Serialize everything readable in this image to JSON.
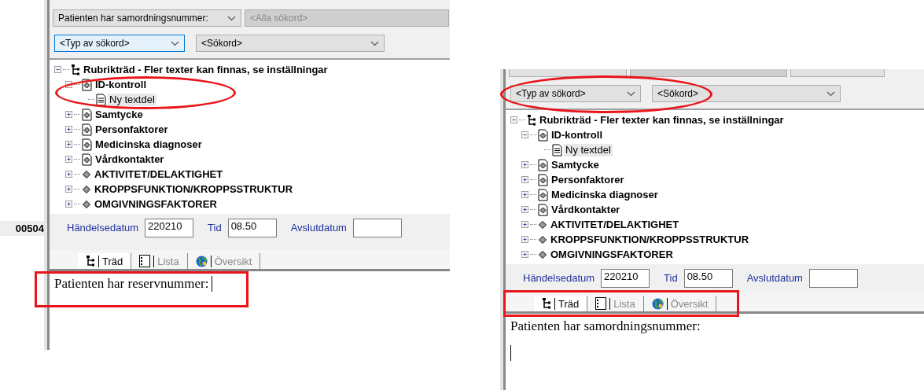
{
  "panels": [
    {
      "gutter_text": "00504",
      "top_combos": [
        {
          "value": "Patienten har samordningsnummer:",
          "disabled": false
        },
        {
          "value": "<Alla sökord>",
          "disabled": true
        }
      ],
      "search_combos": [
        {
          "value": "<Typ av sökord>",
          "focused": true
        },
        {
          "value": "<Sökord>",
          "focused": false
        }
      ],
      "tree": {
        "label": "Rubrikträd - Fler texter kan finnas, se inställningar",
        "expanded": true,
        "children": [
          {
            "label": "ID-kontroll",
            "kind": "document",
            "expanded": true,
            "children": [
              {
                "label": "Ny textdel",
                "kind": "page",
                "selected": true
              }
            ]
          },
          {
            "label": "Samtycke",
            "kind": "document",
            "expanded": false
          },
          {
            "label": "Personfaktorer",
            "kind": "document",
            "expanded": false
          },
          {
            "label": "Medicinska diagnoser",
            "kind": "document",
            "expanded": false
          },
          {
            "label": "Vårdkontakter",
            "kind": "document",
            "expanded": false
          },
          {
            "label": "AKTIVITET/DELAKTIGHET",
            "kind": "category",
            "expanded": false
          },
          {
            "label": "KROPPSFUNKTION/KROPPSSTRUKTUR",
            "kind": "category",
            "expanded": false
          },
          {
            "label": "OMGIVNINGSFAKTORER",
            "kind": "category",
            "expanded": false
          }
        ]
      },
      "date_fields": [
        {
          "label": "Händelsedatum",
          "value": "220210"
        },
        {
          "label": "Tid",
          "value": "08.50"
        },
        {
          "label": "Avslutdatum"
        }
      ],
      "tabs": [
        {
          "label": "Träd",
          "kind": "tree",
          "selected": true
        },
        {
          "label": "Lista",
          "kind": "list",
          "selected": false
        },
        {
          "label": "Översikt",
          "kind": "globe",
          "selected": false
        }
      ],
      "editor": {
        "text": "Patienten har reservnummer:"
      },
      "annotations": [
        {
          "kind": "ellipse"
        },
        {
          "kind": "rectangle"
        }
      ]
    },
    {
      "top_combos": [
        {
          "disabled": false
        },
        {
          "disabled": true
        },
        {
          "disabled": false
        }
      ],
      "search_combos": [
        {
          "value": "<Typ av sökord>",
          "focused": false
        },
        {
          "value": "<Sökord>",
          "focused": false
        }
      ],
      "tree": {
        "label": "Rubrikträd - Fler texter kan finnas, se inställningar",
        "expanded": true,
        "children": [
          {
            "label": "ID-kontroll",
            "kind": "document",
            "expanded": true,
            "children": [
              {
                "label": "Ny textdel",
                "kind": "page",
                "selected": true
              }
            ]
          },
          {
            "label": "Samtycke",
            "kind": "document",
            "expanded": false
          },
          {
            "label": "Personfaktorer",
            "kind": "document",
            "expanded": false
          },
          {
            "label": "Medicinska diagnoser",
            "kind": "document",
            "expanded": false
          },
          {
            "label": "Vårdkontakter",
            "kind": "document",
            "expanded": false
          },
          {
            "label": "AKTIVITET/DELAKTIGHET",
            "kind": "category",
            "expanded": false
          },
          {
            "label": "KROPPSFUNKTION/KROPPSSTRUKTUR",
            "kind": "category",
            "expanded": false
          },
          {
            "label": "OMGIVNINGSFAKTORER",
            "kind": "category",
            "expanded": false
          }
        ]
      },
      "date_fields": [
        {
          "label": "Händelsedatum",
          "value": "220210"
        },
        {
          "label": "Tid",
          "value": "08.50"
        },
        {
          "label": "Avslutdatum"
        }
      ],
      "tabs": [
        {
          "label": "Träd",
          "kind": "tree",
          "selected": true
        },
        {
          "label": "Lista",
          "kind": "list",
          "selected": false
        },
        {
          "label": "Översikt",
          "kind": "globe",
          "selected": false
        }
      ],
      "editor": {
        "text": "Patienten har samordningsnummer:"
      },
      "annotations": [
        {
          "kind": "ellipse"
        },
        {
          "kind": "rectangle"
        }
      ]
    }
  ]
}
